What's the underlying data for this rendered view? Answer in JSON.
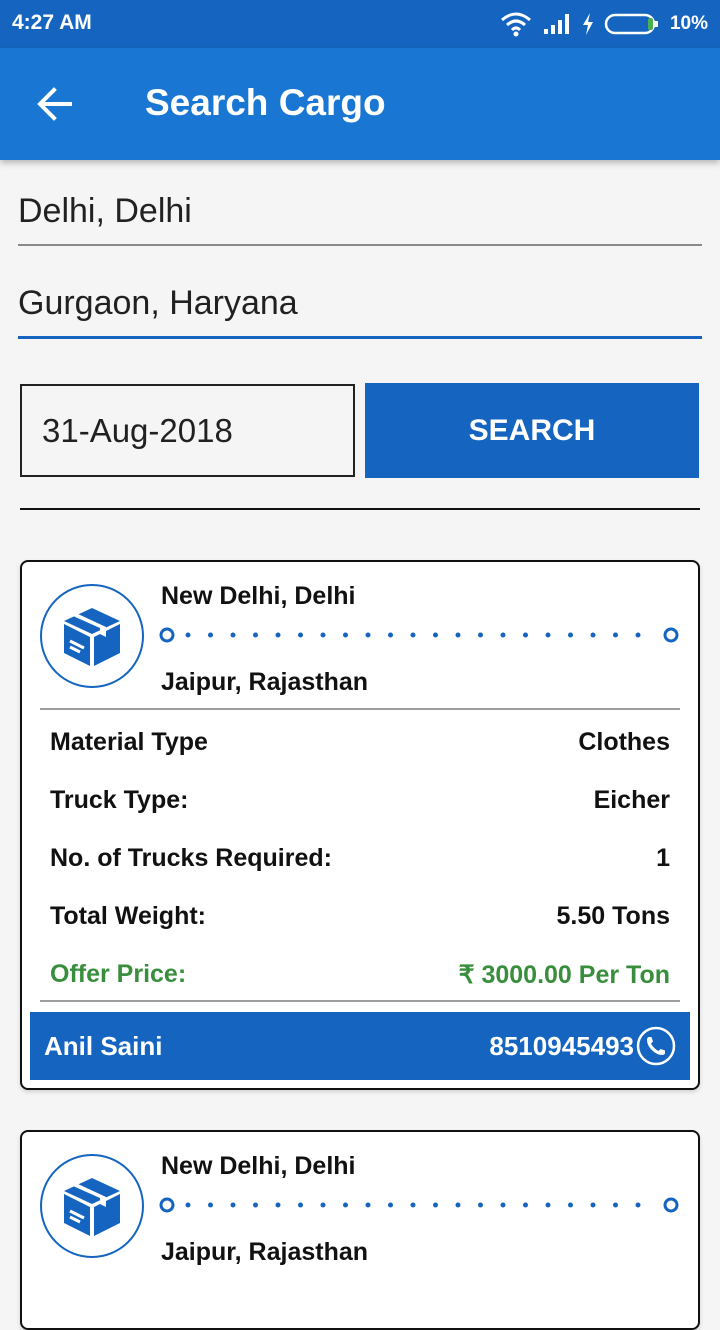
{
  "status": {
    "time": "4:27 AM",
    "battery": "10%"
  },
  "appbar": {
    "title": "Search Cargo"
  },
  "search": {
    "from_value": "Delhi, Delhi",
    "to_value": "Gurgaon, Haryana",
    "date": "31-Aug-2018",
    "button_label": "SEARCH"
  },
  "results": [
    {
      "from": "New Delhi, Delhi",
      "to": "Jaipur, Rajasthan",
      "material_type_label": "Material Type",
      "material_type_value": "Clothes",
      "truck_type_label": "Truck Type:",
      "truck_type_value": "Eicher",
      "trucks_required_label": "No. of Trucks Required:",
      "trucks_required_value": "1",
      "total_weight_label": "Total Weight:",
      "total_weight_value": "5.50 Tons",
      "offer_price_label": "Offer Price:",
      "offer_price_value": "₹ 3000.00 Per Ton",
      "contact_name": "Anil Saini",
      "contact_phone": "8510945493"
    },
    {
      "from": "New Delhi, Delhi",
      "to": "Jaipur, Rajasthan"
    }
  ],
  "colors": {
    "primary": "#1976d2",
    "primary_dark": "#1565c0",
    "offer_green": "#388e3c"
  },
  "icons": [
    "back-arrow-icon",
    "wifi-icon",
    "signal-icon",
    "charging-icon",
    "battery-icon",
    "cargo-box-icon",
    "phone-icon"
  ]
}
